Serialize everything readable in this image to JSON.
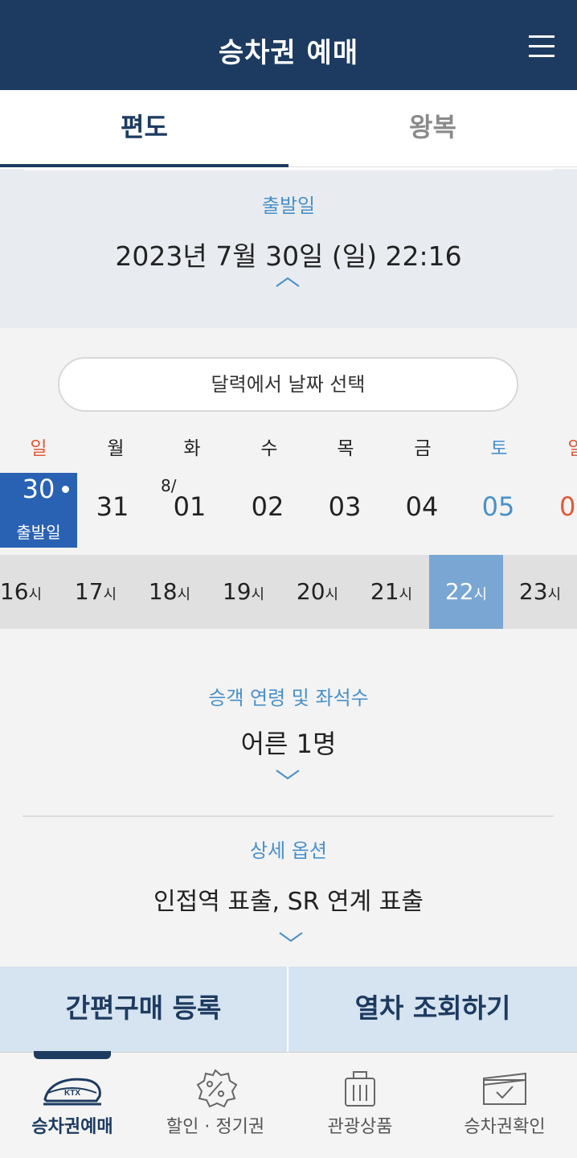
{
  "header": {
    "title": "승차권 예매",
    "menu_icon": "hamburger-menu-icon"
  },
  "tabs": [
    {
      "label": "편도",
      "active": true
    },
    {
      "label": "왕복",
      "active": false
    }
  ],
  "departure": {
    "label": "출발일",
    "value": "2023년 7월 30일 (일) 22:16"
  },
  "calendar": {
    "button_label": "달력에서 날짜 선택",
    "weekdays": [
      "일",
      "월",
      "화",
      "수",
      "목",
      "금",
      "토",
      "일"
    ],
    "days": [
      {
        "num": "30",
        "sub": "출발일",
        "selected": true
      },
      {
        "num": "31"
      },
      {
        "num": "01",
        "month": "8/"
      },
      {
        "num": "02"
      },
      {
        "num": "03"
      },
      {
        "num": "04"
      },
      {
        "num": "05"
      },
      {
        "num": "0"
      }
    ],
    "hours": [
      "16",
      "17",
      "18",
      "19",
      "20",
      "21",
      "22",
      "23"
    ],
    "hour_suffix": "시",
    "selected_hour": "22"
  },
  "passenger": {
    "label": "승객 연령 및 좌석수",
    "value": "어른 1명"
  },
  "options": {
    "label": "상세 옵션",
    "value": "인접역 표출, SR 연계 표출"
  },
  "actions": {
    "quick_purchase": "간편구매 등록",
    "search_trains": "열차 조회하기"
  },
  "bottom_nav": [
    {
      "label": "승차권예매",
      "icon": "ktx-train-icon",
      "active": true
    },
    {
      "label": "할인 · 정기권",
      "icon": "discount-badge-icon",
      "active": false
    },
    {
      "label": "관광상품",
      "icon": "luggage-icon",
      "active": false
    },
    {
      "label": "승차권확인",
      "icon": "ticket-check-icon",
      "active": false
    }
  ],
  "colors": {
    "primary": "#1d3b60",
    "accent": "#4a90c8",
    "sunday": "#e05a3a",
    "selected_day": "#2a62b3",
    "selected_hour": "#7aa6d3"
  }
}
